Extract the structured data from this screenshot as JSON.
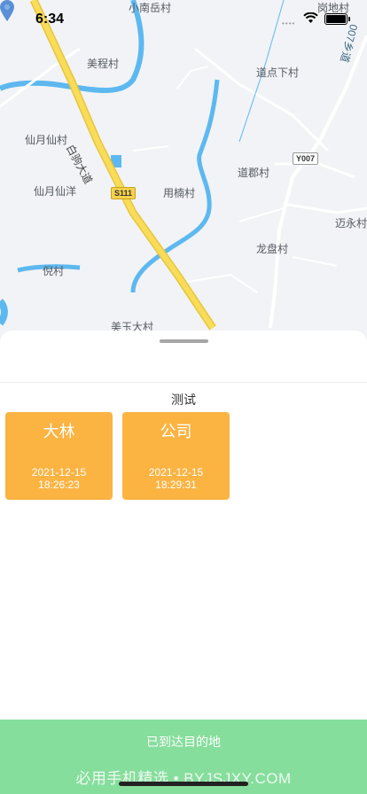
{
  "status_bar": {
    "time": "6:34"
  },
  "map": {
    "labels": {
      "meicheng": "美程村",
      "xiaonanyue": "小南岳村",
      "xianyue": "仙月仙村",
      "xianyang": "仙月仙洋",
      "ni": "倪村",
      "meiyuda": "美玉大村",
      "yongnan": "用楠村",
      "daodianxia": "道点下村",
      "daojun": "道郡村",
      "longpan": "龙盘村",
      "maiyong": "迈永村",
      "road_baiju": "白驹大道",
      "road_xiang": "007乡道",
      "gangdi": "岗地村"
    },
    "shields": {
      "s111": "S111",
      "y007": "Y007"
    }
  },
  "sheet": {
    "group_title": "测试",
    "cards": [
      {
        "name": "大林",
        "date": "2021-12-15",
        "time": "18:26:23"
      },
      {
        "name": "公司",
        "date": "2021-12-15",
        "time": "18:29:31"
      }
    ]
  },
  "actions": {
    "arrive_label": "已到达目的地"
  },
  "watermark": "必用手机精选 • BYJSJXY.COM"
}
